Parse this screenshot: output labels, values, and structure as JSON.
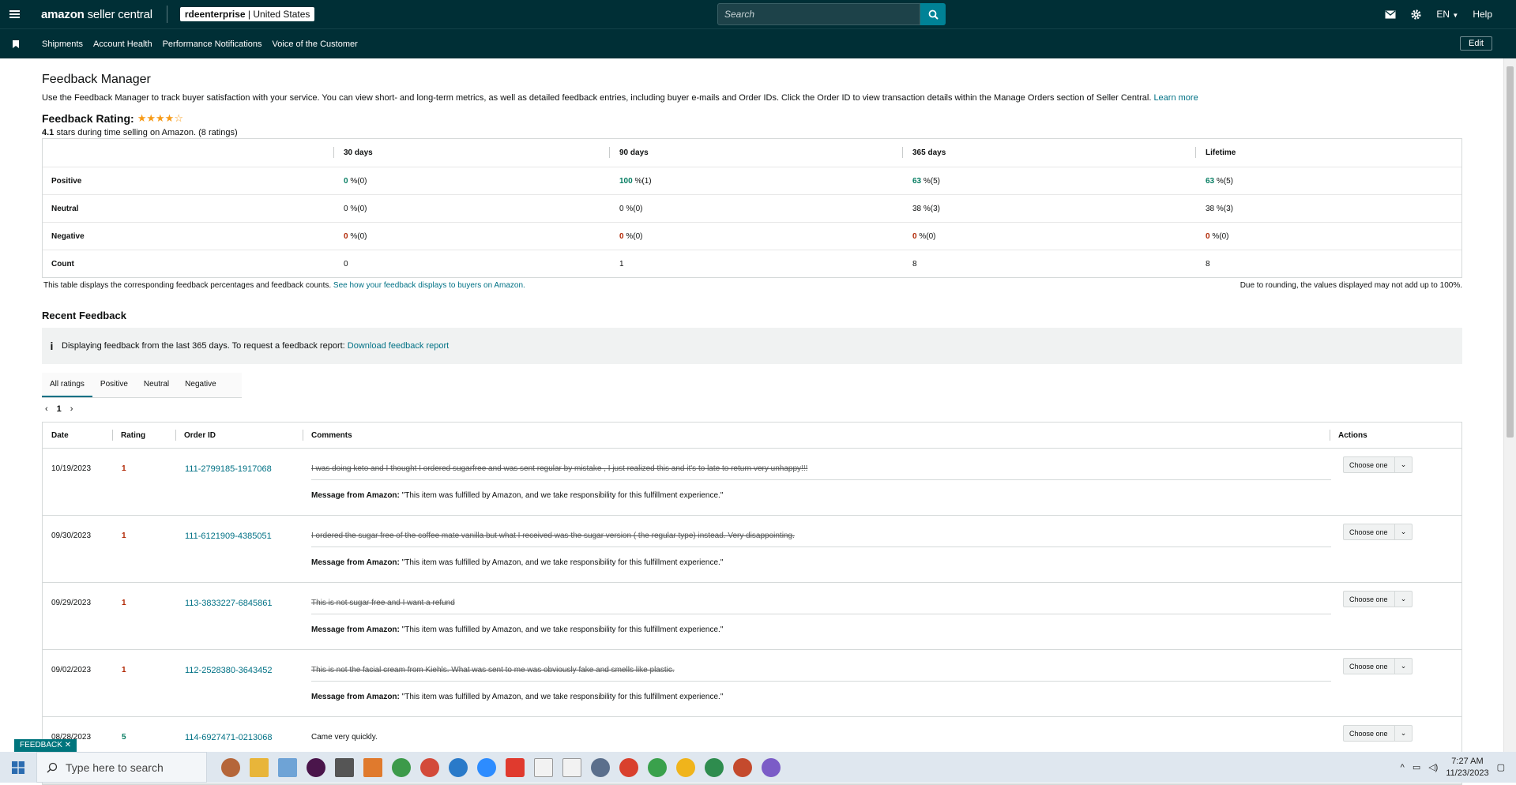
{
  "topbar": {
    "logo_bold": "amazon",
    "logo_sub": "seller central",
    "store_name": "rdeenterprise",
    "store_region": "| United States",
    "search_placeholder": "Search",
    "language": "EN",
    "help": "Help"
  },
  "subnav": {
    "items": [
      "Shipments",
      "Account Health",
      "Performance Notifications",
      "Voice of the Customer"
    ],
    "edit": "Edit"
  },
  "page": {
    "title": "Feedback Manager",
    "description": "Use the Feedback Manager to track buyer satisfaction with your service. You can view short- and long-term metrics, as well as detailed feedback entries, including buyer e-mails and Order IDs. Click the Order ID to view transaction details within the Manage Orders section of Seller Central.",
    "learn_more": "Learn more",
    "rating_title": "Feedback Rating:",
    "rating_stars": 4.1,
    "rating_value": "4.1",
    "rating_sub": "stars during time selling on Amazon. (8 ratings)"
  },
  "metrics": {
    "headers": [
      "30 days",
      "90 days",
      "365 days",
      "Lifetime"
    ],
    "rows": [
      {
        "label": "Positive",
        "cells": [
          {
            "n": "0",
            "rest": " %(0)"
          },
          {
            "n": "100",
            "rest": " %(1)"
          },
          {
            "n": "63",
            "rest": " %(5)"
          },
          {
            "n": "63",
            "rest": " %(5)"
          }
        ]
      },
      {
        "label": "Neutral",
        "cells": [
          {
            "n": "0",
            "rest": " %(0)"
          },
          {
            "n": "0",
            "rest": " %(0)"
          },
          {
            "n": "38",
            "rest": " %(3)"
          },
          {
            "n": "38",
            "rest": " %(3)"
          }
        ]
      },
      {
        "label": "Negative",
        "cells": [
          {
            "n": "0",
            "rest": " %(0)"
          },
          {
            "n": "0",
            "rest": " %(0)"
          },
          {
            "n": "0",
            "rest": " %(0)"
          },
          {
            "n": "0",
            "rest": " %(0)"
          }
        ]
      },
      {
        "label": "Count",
        "cells": [
          {
            "n": "0",
            "rest": ""
          },
          {
            "n": "1",
            "rest": ""
          },
          {
            "n": "8",
            "rest": ""
          },
          {
            "n": "8",
            "rest": ""
          }
        ]
      }
    ],
    "note_left": "This table displays the corresponding feedback percentages and feedback counts.",
    "note_link": "See how your feedback displays to buyers on Amazon.",
    "note_right": "Due to rounding, the values displayed may not add up to 100%."
  },
  "recent": {
    "title": "Recent Feedback",
    "info_text": "Displaying feedback from the last 365 days. To request a feedback report:",
    "info_link": "Download feedback report",
    "tabs": [
      "All ratings",
      "Positive",
      "Neutral",
      "Negative"
    ],
    "page": "1",
    "columns": [
      "Date",
      "Rating",
      "Order ID",
      "Comments",
      "Actions"
    ],
    "message_label": "Message from Amazon:",
    "message_text": "\"This item was fulfilled by Amazon, and we take responsibility for this fulfillment experience.\"",
    "action_label": "Choose one",
    "rows": [
      {
        "date": "10/19/2023",
        "rating": "1",
        "order": "111-2799185-1917068",
        "comment": "I was doing keto and I thought I ordered sugarfree and was sent regular by mistake , I just realized this and it's to late to return very unhappy!!!"
      },
      {
        "date": "09/30/2023",
        "rating": "1",
        "order": "111-6121909-4385051",
        "comment": "I ordered the sugar free of the coffee mate vanilla but what I received was the sugar version ( the regular type) instead. Very disappointing."
      },
      {
        "date": "09/29/2023",
        "rating": "1",
        "order": "113-3833227-6845861",
        "comment": "This is not sugar free and I want a refund"
      },
      {
        "date": "09/02/2023",
        "rating": "1",
        "order": "112-2528380-3643452",
        "comment": "This is not the facial cream from Kiehls. What was sent to me was obviously fake and smells like plastic."
      },
      {
        "date": "08/28/2023",
        "rating": "5",
        "order": "114-6927471-0213068",
        "comment": "Came very quickly."
      }
    ]
  },
  "feedback_pill": "FEEDBACK",
  "taskbar": {
    "search_placeholder": "Type here to search",
    "time": "7:27 AM",
    "date": "11/23/2023"
  }
}
